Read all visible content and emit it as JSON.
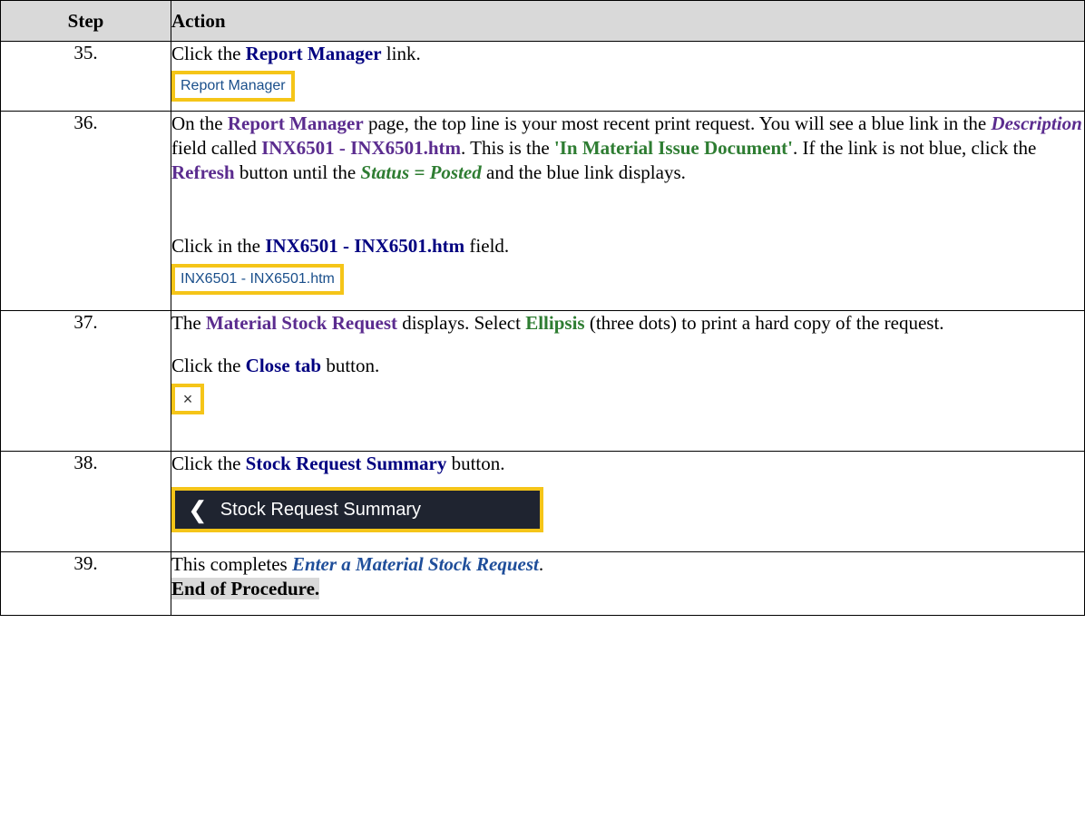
{
  "header": {
    "step": "Step",
    "action": "Action"
  },
  "rows": {
    "r35": {
      "step": "35.",
      "t1": "Click the ",
      "t2": "Report Manager",
      "t3": " link.",
      "btn": "Report Manager"
    },
    "r36": {
      "step": "36.",
      "a1": "On the ",
      "a2": "Report Manager",
      "a3": " page, the top line is your most recent print request. You will see a blue link in the ",
      "a4": "Description",
      "a5": " field called ",
      "a6": "INX6501 - INX6501.htm",
      "a7": ". This is the ",
      "a8": "'In Material Issue Document'",
      "a9": ". If the link is not blue, click the ",
      "a10": "Refresh",
      "a11": " button until the ",
      "a12": "Status = Posted",
      "a13": " and the blue link displays.",
      "b1": "Click in the ",
      "b2": "INX6501 - INX6501.htm",
      "b3": " field.",
      "btn": "INX6501 - INX6501.htm"
    },
    "r37": {
      "step": "37.",
      "a1": "The ",
      "a2": "Material Stock Request",
      "a3": " displays. Select ",
      "a4": "Ellipsis",
      "a5": " (three dots) to print a hard copy of the request.",
      "b1": "Click the ",
      "b2": "Close tab",
      "b3": " button.",
      "icon": "×"
    },
    "r38": {
      "step": "38.",
      "t1": "Click the ",
      "t2": "Stock Request Summary",
      "t3": " button.",
      "chev": "❮",
      "btn": "Stock Request Summary"
    },
    "r39": {
      "step": "39.",
      "t1": "This completes ",
      "t2": "Enter a Material Stock Request",
      "t3": ".",
      "end": "End of Procedure."
    }
  }
}
